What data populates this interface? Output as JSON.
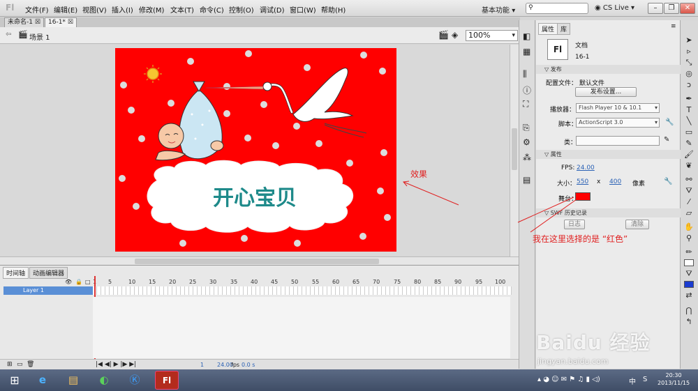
{
  "app": {
    "logo": "Fl"
  },
  "menu": [
    "文件(F)",
    "编辑(E)",
    "视图(V)",
    "插入(I)",
    "修改(M)",
    "文本(T)",
    "命令(C)",
    "控制(O)",
    "调试(D)",
    "窗口(W)",
    "帮助(H)"
  ],
  "workspace": "基本功能",
  "cs_live": "CS Live",
  "doc_tabs": [
    "未命名-1",
    "16-1*"
  ],
  "scene": "场景 1",
  "zoom": "100%",
  "stage": {
    "color": "#ff0000",
    "title_text": "开心宝贝"
  },
  "timeline": {
    "tabs": [
      "时间轴",
      "动画编辑器"
    ],
    "layer": "Layer 1",
    "ruler": [
      "1",
      "5",
      "10",
      "15",
      "20",
      "25",
      "30",
      "35",
      "40",
      "45",
      "50",
      "55",
      "60",
      "65",
      "70",
      "75",
      "80",
      "85",
      "90",
      "95",
      "100"
    ],
    "fps": "24.00",
    "fps_unit": "fps",
    "time": "0.0 s",
    "frame": "1"
  },
  "props": {
    "tabs": [
      "属性",
      "库"
    ],
    "doc_label": "文档",
    "doc_name": "16-1",
    "doc_icon": "Fl",
    "publish_header": "发布",
    "profile_label": "配置文件：",
    "profile_value": "默认文件",
    "publish_settings_btn": "发布设置...",
    "player_label": "播放器：",
    "player_value": "Flash Player 10 & 10.1",
    "script_label": "脚本：",
    "script_value": "ActionScript 3.0",
    "class_label": "类：",
    "class_value": "",
    "properties_header": "属性",
    "fps_label": "FPS:",
    "fps_value": "24.00",
    "size_label": "大小：",
    "width": "550",
    "x": "x",
    "height": "400",
    "unit": "像素",
    "stage_label": "舞台：",
    "stage_color": "#ff0000",
    "swf_header": "SWF 历史记录",
    "log_btn": "日志",
    "clear_btn": "清除"
  },
  "annotations": {
    "effect": "效果",
    "note": "我在这里选择的是 “红色”"
  },
  "watermark": {
    "text": "Baidu 经验",
    "url": "jingyan.baidu.com"
  },
  "taskbar": {
    "time": "20:30",
    "date": "2013/11/15",
    "lang": "中"
  }
}
